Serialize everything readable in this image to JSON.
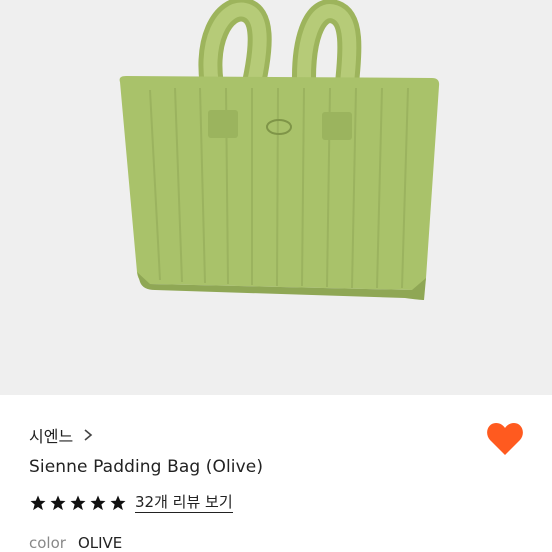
{
  "product": {
    "brand": "시엔느",
    "title": "Sienne Padding Bag (Olive)",
    "rating_stars": 5,
    "reviews_link": "32개 리뷰 보기",
    "option_label": "color",
    "option_value": "OLIVE"
  },
  "icons": {
    "brand_chevron": "chevron-right-icon",
    "wishlist": "heart-icon",
    "star": "star-icon"
  },
  "colors": {
    "bag": "#a9c26a",
    "heart": "#ff5a1f",
    "background": "#efefef"
  }
}
